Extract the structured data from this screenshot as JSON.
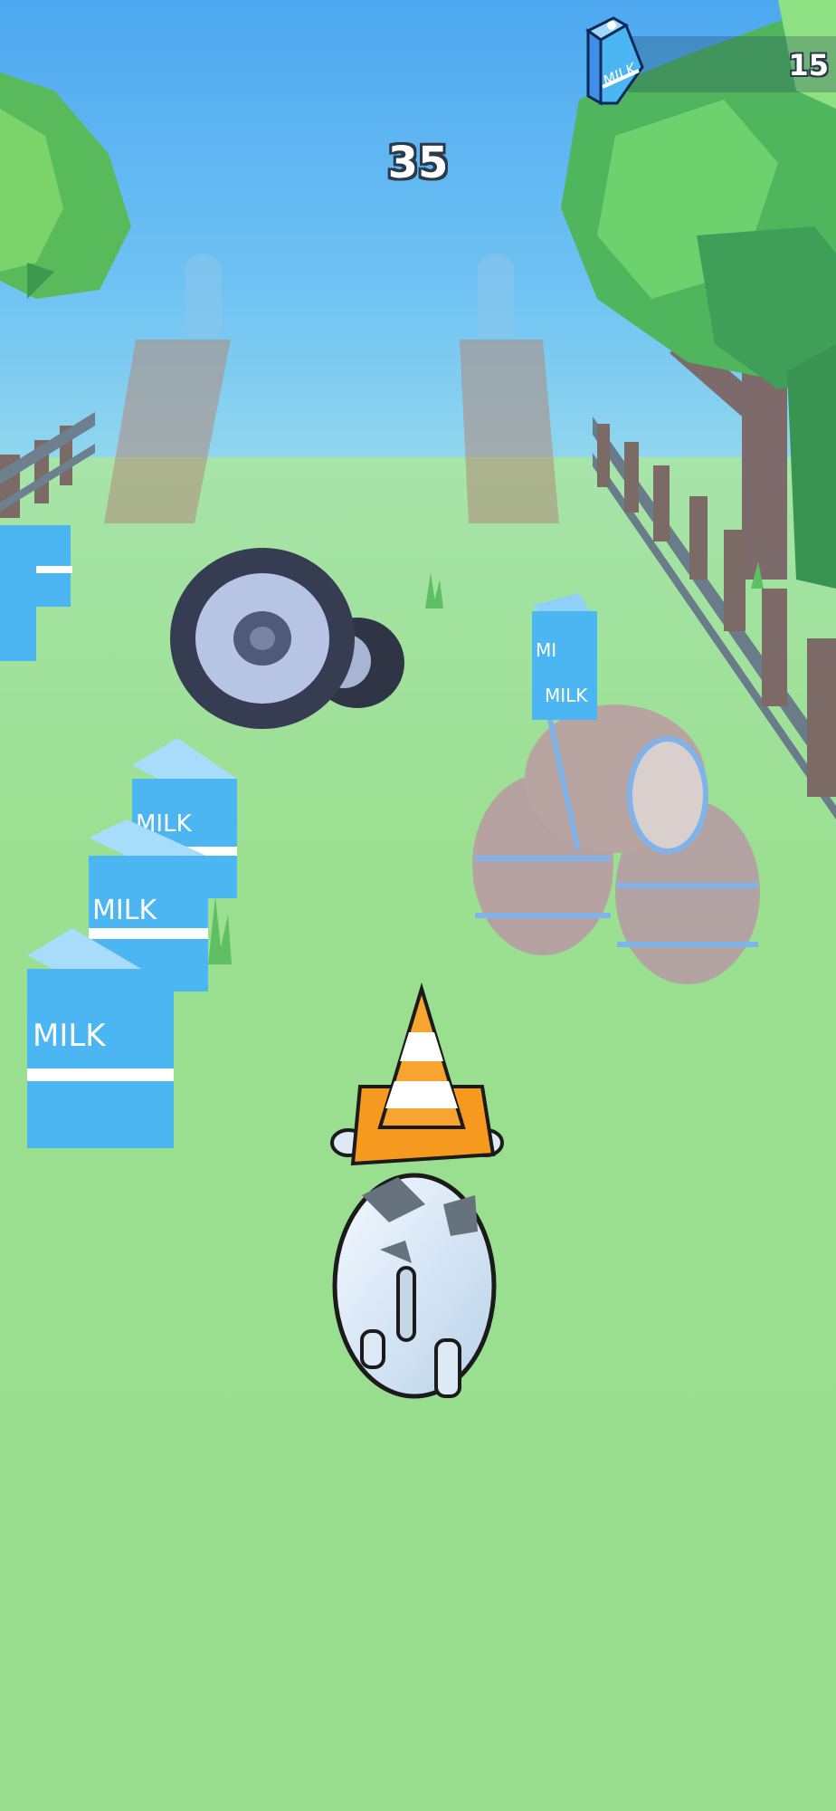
{
  "hud": {
    "score": "35",
    "milk_count": "15",
    "milk_icon": "milk-carton-icon"
  },
  "carton_text": "MILK",
  "colors": {
    "sky": "#5cb2f2",
    "grass": "#9bdf91",
    "milk_carton": "#4cb6f2",
    "cone": "#f7a530",
    "tree": "#5bc76a"
  }
}
